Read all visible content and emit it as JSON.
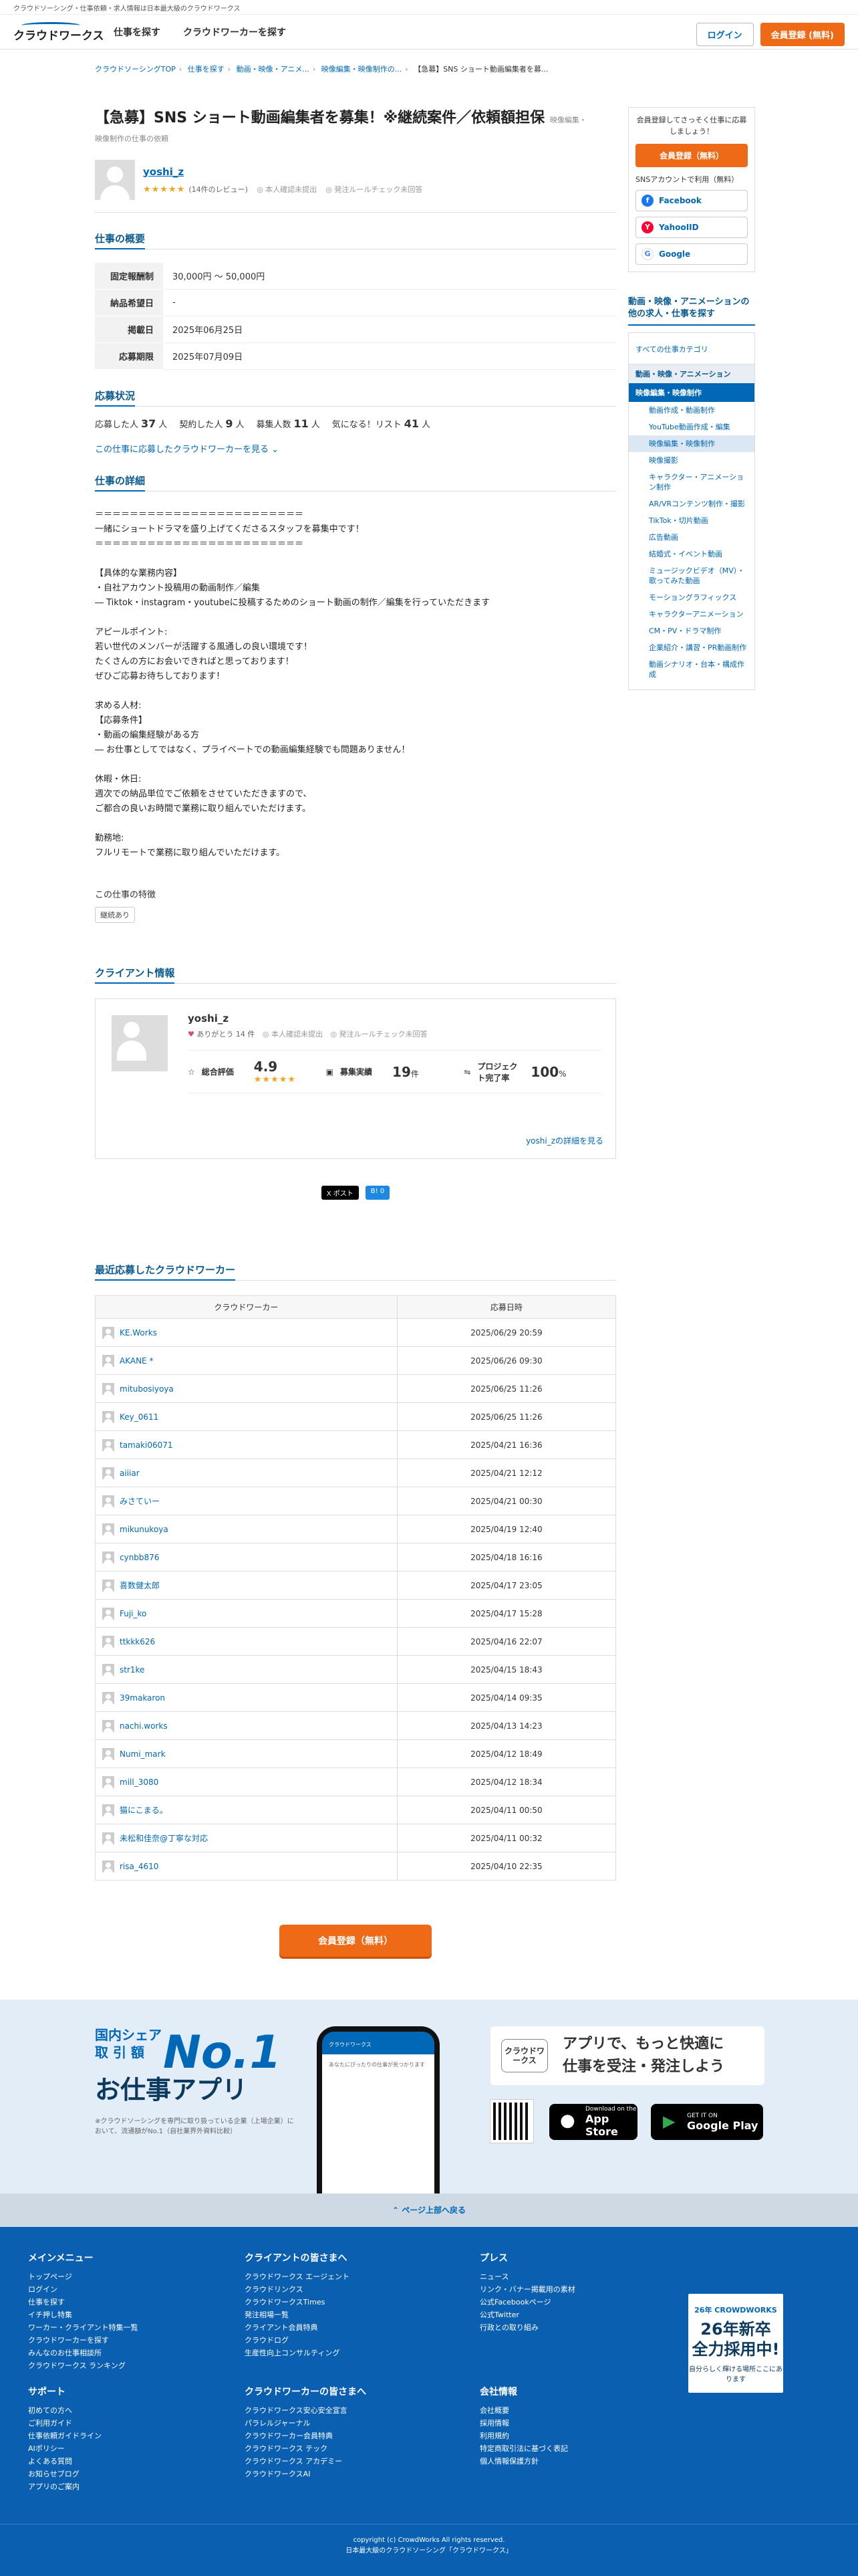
{
  "topbar": {
    "text": "クラウドソーシング・仕事依頼・求人情報は日本最大級のクラウドワークス"
  },
  "header": {
    "logo": "クラウドワークス",
    "nav": [
      "仕事を探す",
      "クラウドワーカーを探す"
    ],
    "login": "ログイン",
    "register": "会員登録 (無料)"
  },
  "breadcrumb": [
    "クラウドソーシングTOP",
    "仕事を探す",
    "動画・映像・アニメ...",
    "映像編集・映像制作の...",
    "【急募】SNS ショート動画編集者を募..."
  ],
  "job": {
    "title": "【急募】SNS ショート動画編集者を募集！※継続案件／依頼額担保",
    "category_tag": "映像編集・",
    "category_line": "映像制作の仕事の依頼",
    "user": {
      "name": "yoshi_z",
      "stars": "★★★★★",
      "reviews": "(14件のレビュー)",
      "identity": "本人確認未提出",
      "rules": "発注ルールチェック未回答"
    }
  },
  "overview": {
    "heading": "仕事の概要",
    "rows": [
      {
        "label": "固定報酬制",
        "value": "30,000円 〜 50,000円"
      },
      {
        "label": "納品希望日",
        "value": "-"
      },
      {
        "label": "掲載日",
        "value": "2025年06月25日"
      },
      {
        "label": "応募期限",
        "value": "2025年07月09日"
      }
    ]
  },
  "status": {
    "heading": "応募状況",
    "applicants_label": "応募した人",
    "applicants": "37",
    "applicants_unit": "人",
    "contracted_label": "契約した人",
    "contracted": "9",
    "contracted_unit": "人",
    "recruit_label": "募集人数",
    "recruit": "11",
    "recruit_unit": "人",
    "watch_label": "気になる！リスト",
    "watch": "41",
    "watch_unit": "人",
    "link": "この仕事に応募したクラウドワーカーを見る"
  },
  "detail": {
    "heading": "仕事の詳細",
    "body": "＝＝＝＝＝＝＝＝＝＝＝＝＝＝＝＝＝＝＝＝＝＝＝＝\n一緒にショートドラマを盛り上げてくださるスタッフを募集中です！\n＝＝＝＝＝＝＝＝＝＝＝＝＝＝＝＝＝＝＝＝＝＝＝＝\n\n【具体的な業務内容】\n・自社アカウント投稿用の動画制作／編集\n― Tiktok・instagram・youtubeに投稿するためのショート動画の制作／編集を行っていただきます\n\nアピールポイント:\n若い世代のメンバーが活躍する風通しの良い環境です！\nたくさんの方にお会いできればと思っております！\nぜひご応募お待ちしております！\n\n求める人材:\n【応募条件】\n・動画の編集経験がある方\n― お仕事としてではなく、プライベートでの動画編集経験でも問題ありません！\n\n休暇・休日:\n週次での納品単位でご依頼をさせていただきますので、\nご都合の良いお時間で業務に取り組んでいただけます。\n\n勤務地:\nフルリモートで業務に取り組んでいただけます。",
    "features_label": "この仕事の特徴",
    "tag": "継続あり"
  },
  "client": {
    "heading": "クライアント情報",
    "name": "yoshi_z",
    "thanks": "ありがとう 14 件",
    "identity": "本人確認未提出",
    "rules": "発注ルールチェック未回答",
    "rating_label": "総合評価",
    "rating": "4.9",
    "stars": "★★★★★",
    "record_label": "募集実績",
    "record": "19",
    "record_unit": "件",
    "completion_label": "プロジェクト完了率",
    "completion": "100",
    "completion_unit": "%",
    "more": "yoshi_zの詳細を見る"
  },
  "share": {
    "x": "X ポスト",
    "b": "B! 0"
  },
  "recent": {
    "heading": "最近応募したクラウドワーカー",
    "col_worker": "クラウドワーカー",
    "col_date": "応募日時",
    "rows": [
      {
        "name": "KE.Works",
        "date": "2025/06/29 20:59"
      },
      {
        "name": "AKANE *",
        "date": "2025/06/26 09:30"
      },
      {
        "name": "mitubosiyoya",
        "date": "2025/06/25 11:26"
      },
      {
        "name": "Key_0611",
        "date": "2025/06/25 11:26"
      },
      {
        "name": "tamaki06071",
        "date": "2025/04/21 16:36"
      },
      {
        "name": "aiiiar",
        "date": "2025/04/21 12:12"
      },
      {
        "name": "みさていー",
        "date": "2025/04/21 00:30"
      },
      {
        "name": "mikunukoya",
        "date": "2025/04/19 12:40"
      },
      {
        "name": "cynbb876",
        "date": "2025/04/18 16:16"
      },
      {
        "name": "喜数健太郎",
        "date": "2025/04/17 23:05"
      },
      {
        "name": "Fuji_ko",
        "date": "2025/04/17 15:28"
      },
      {
        "name": "ttkkk626",
        "date": "2025/04/16 22:07"
      },
      {
        "name": "str1ke",
        "date": "2025/04/15 18:43"
      },
      {
        "name": "39makaron",
        "date": "2025/04/14 09:35"
      },
      {
        "name": "nachi.works",
        "date": "2025/04/13 14:23"
      },
      {
        "name": "Numi_mark",
        "date": "2025/04/12 18:49"
      },
      {
        "name": "mill_3080",
        "date": "2025/04/12 18:34"
      },
      {
        "name": "猫にこまる。",
        "date": "2025/04/11 00:50"
      },
      {
        "name": "未松和佳奈@丁寧な対応",
        "date": "2025/04/11 00:32"
      },
      {
        "name": "risa_4610",
        "date": "2025/04/10 22:35"
      }
    ]
  },
  "cta": "会員登録（無料）",
  "sidebar": {
    "promo": "会員登録してさっそく仕事に応募しましょう！",
    "register": "会員登録（無料）",
    "sns_label": "SNSアカウントで利用（無料）",
    "sns": [
      "Facebook",
      "YahooIID",
      "Google"
    ],
    "jobs_heading": "動画・映像・アニメーションの他の求人・仕事を探す",
    "all": "すべての仕事カテゴリ",
    "group": "動画・映像・アニメーション",
    "group_on": "映像編集・映像制作",
    "items": [
      "動画作成・動画制作",
      "YouTube動画作成・編集",
      "映像編集・映像制作",
      "映像撮影",
      "キャラクター・アニメーション制作",
      "AR/VRコンテンツ制作・撮影",
      "TikTok・切片動画",
      "広告動画",
      "結婚式・イベント動画",
      "ミュージックビデオ（MV）・歌ってみた動画",
      "モーショングラフィックス",
      "キャラクターアニメーション",
      "CM・PV・ドラマ制作",
      "企業紹介・講習・PR動画制作",
      "動画シナリオ・台本・構成作成"
    ],
    "active_index": 2
  },
  "appband": {
    "share": "国内シェア",
    "amount": "取 引 額",
    "no1": "No.1",
    "title": "お仕事アプリ",
    "note": "※クラウドソーシングを専門に取り扱っている企業（上場企業）において、流通額がNo.1（自社業界外資料比較）",
    "logo": "クラウドワークス",
    "copy1": "アプリで、もっと快適に",
    "copy2": "仕事を受注・発注しよう",
    "appstore_small": "Download on the",
    "appstore": "App Store",
    "gplay_small": "GET IT ON",
    "gplay": "Google Play",
    "phone_header": "クラウドワークス",
    "phone_text": "あなたにぴったりの仕事が見つかります"
  },
  "pagetop": "ページ上部へ戻る",
  "footer": {
    "menu": {
      "title": "メインメニュー",
      "items": [
        "トップページ",
        "ログイン",
        "仕事を探す",
        "イチ押し特集",
        "ワーカー・クライアント特集一覧",
        "クラウドワーカーを探す",
        "みんなのお仕事相談所",
        "クラウドワークス ランキング"
      ]
    },
    "clients": {
      "title": "クライアントの皆さまへ",
      "items": [
        "クラウドワークス エージェント",
        "クラウドリンクス",
        "クラウドワークスTimes",
        "発注相場一覧",
        "クライアント会員特典",
        "クラウドログ",
        "生産性向上コンサルティング"
      ]
    },
    "press": {
      "title": "プレス",
      "items": [
        "ニュース",
        "リンク・バナー掲載用の素材",
        "公式Facebookページ",
        "公式Twitter",
        "行政との取り組み"
      ]
    },
    "support": {
      "title": "サポート",
      "items": [
        "初めての方へ",
        "ご利用ガイド",
        "仕事依頼ガイドライン",
        "AIポリシー",
        "よくある質問",
        "お知らせブログ",
        "アプリのご案内"
      ]
    },
    "workers": {
      "title": "クラウドワーカーの皆さまへ",
      "items": [
        "クラウドワークス安心安全宣言",
        "パラレルジャーナル",
        "クラウドワーカー会員特典",
        "クラウドワークス テック",
        "クラウドワークス アカデミー",
        "クラウドワークスAI"
      ]
    },
    "company": {
      "title": "会社情報",
      "items": [
        "会社概要",
        "採用情報",
        "利用規約",
        "特定商取引法に基づく表記",
        "個人情報保護方針"
      ]
    },
    "banner": {
      "brand": "26年 CROWDWORKS",
      "line1": "26年新卒",
      "line2": "全力採用中!",
      "line3": "自分らしく輝ける場所ここにあります"
    },
    "copyright": "copyright (c) CrowdWorks All rights reserved.",
    "tagline": "日本最大級のクラウドソーシング「クラウドワークス」"
  }
}
